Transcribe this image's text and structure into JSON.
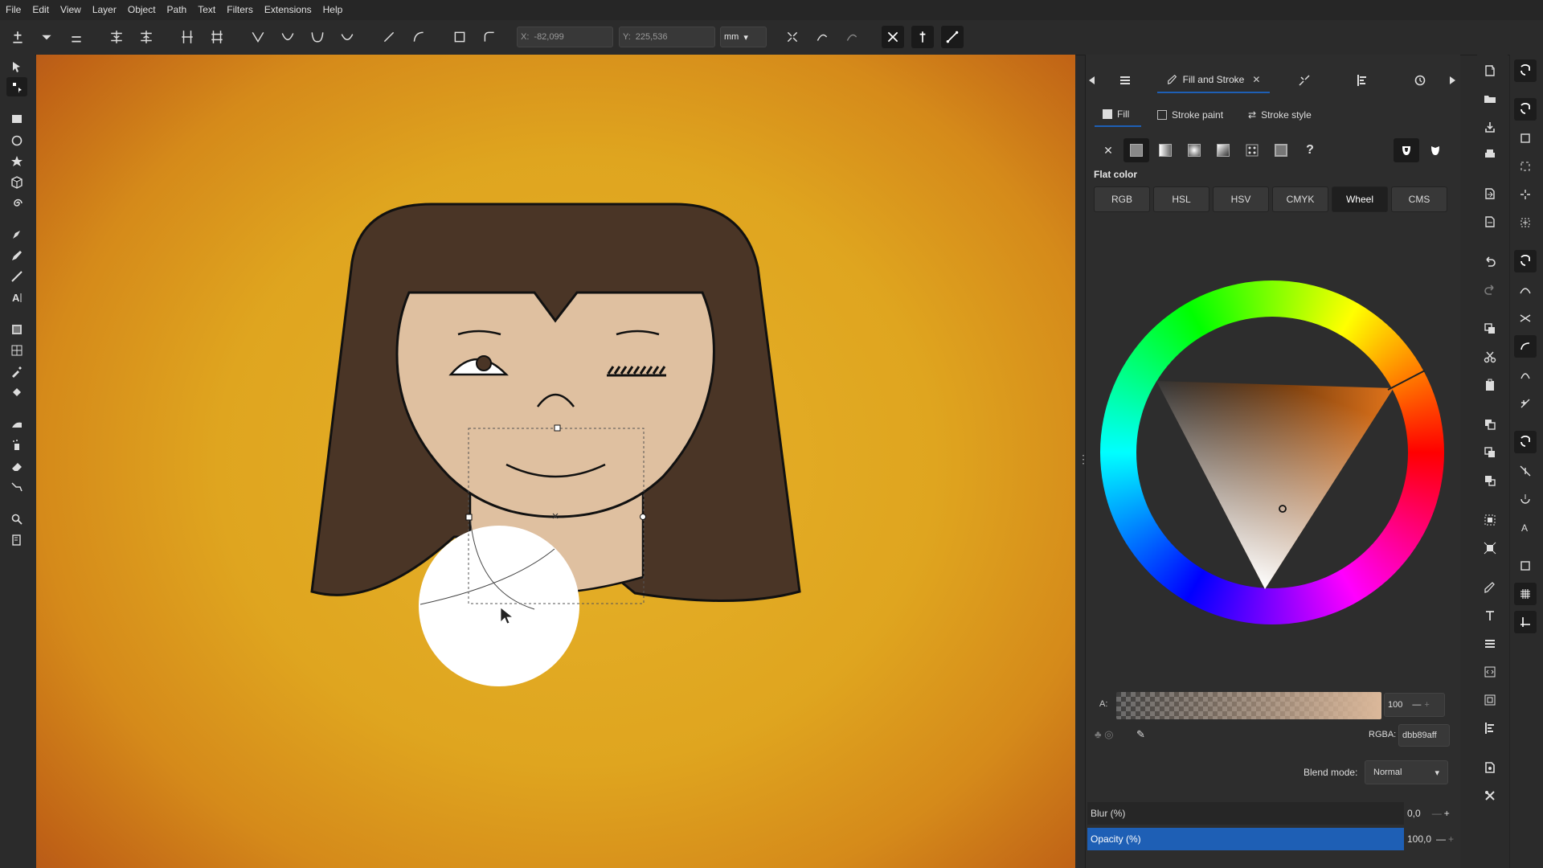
{
  "menu": [
    "File",
    "Edit",
    "View",
    "Layer",
    "Object",
    "Path",
    "Text",
    "Filters",
    "Extensions",
    "Help"
  ],
  "toolctl": {
    "x_label": "X:",
    "x_value": "-82,099",
    "y_label": "Y:",
    "y_value": "225,536",
    "unit": "mm"
  },
  "dock": {
    "tab_title": "Fill and Stroke",
    "subtabs": {
      "fill": "Fill",
      "stroke_paint": "Stroke paint",
      "stroke_style": "Stroke style"
    },
    "paint_type_label": "Flat color",
    "modes": [
      "RGB",
      "HSL",
      "HSV",
      "CMYK",
      "Wheel",
      "CMS"
    ],
    "active_mode": "Wheel",
    "alpha_label": "A:",
    "alpha_value": "100",
    "rgba_label": "RGBA:",
    "rgba_value": "dbb89aff",
    "blend_label": "Blend mode:",
    "blend_value": "Normal",
    "blur_label": "Blur (%)",
    "blur_value": "0,0",
    "opacity_label": "Opacity (%)",
    "opacity_value": "100,0"
  },
  "colors": {
    "accent": "#1e5fb5",
    "hair": "#4a3526",
    "skin": "#dfc0a0",
    "fill_color": "#dbb89a"
  }
}
